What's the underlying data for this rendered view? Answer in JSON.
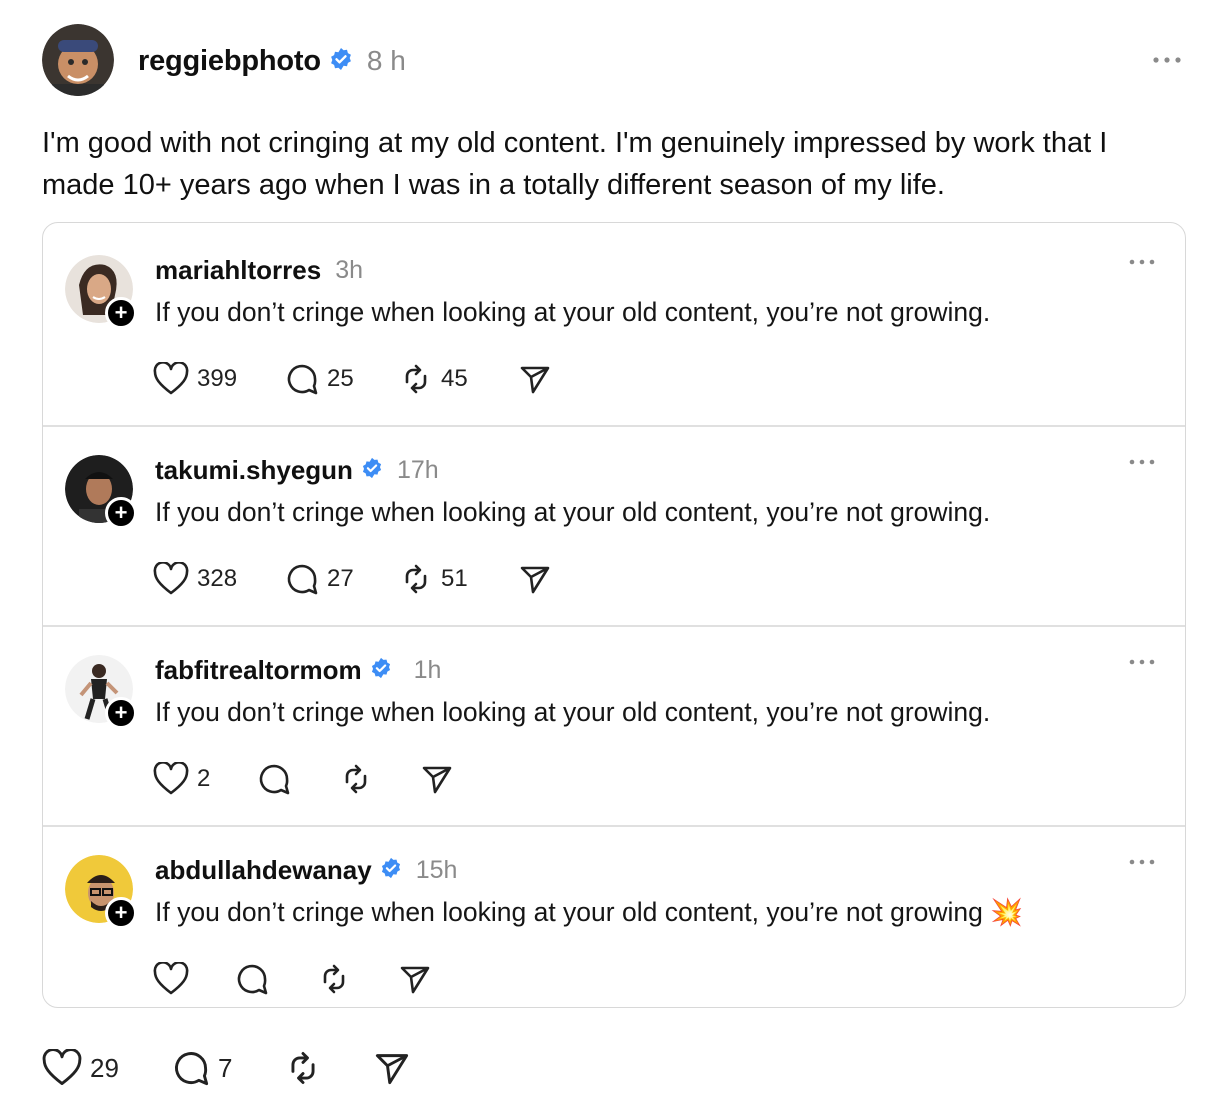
{
  "post": {
    "username": "reggiebphoto",
    "verified": true,
    "time": "8 h",
    "text": "I'm good with not cringing at my old content. I'm genuinely impressed by work that I made 10+ years ago when I was in a totally different season of my life.",
    "likes": "29",
    "replies": "7",
    "reposts": "",
    "more_icon": "more-icon"
  },
  "quoted_replies": [
    {
      "username": "mariahltorres",
      "verified": false,
      "time": "3h",
      "text": "If you don’t cringe when looking at your old content, you’re not growing.",
      "likes": "399",
      "comments": "25",
      "reposts": "45"
    },
    {
      "username": "takumi.shyegun",
      "verified": true,
      "time": "17h",
      "text": "If you don’t cringe when looking at your old content, you’re not growing.",
      "likes": "328",
      "comments": "27",
      "reposts": "51"
    },
    {
      "username": "fabfitrealtormom",
      "verified": true,
      "time": "1h",
      "text": "If you don’t cringe when looking at your old content, you’re not growing.",
      "likes": "2",
      "comments": "",
      "reposts": ""
    },
    {
      "username": "abdullahdewanay",
      "verified": true,
      "time": "15h",
      "text": "If you don’t cringe when looking at your old content, you’re not growing 💥",
      "likes": "",
      "comments": "",
      "reposts": ""
    }
  ],
  "colors": {
    "verified_blue": "#3d8df5",
    "muted": "#8a8a8a",
    "border": "#d8d8d8"
  }
}
